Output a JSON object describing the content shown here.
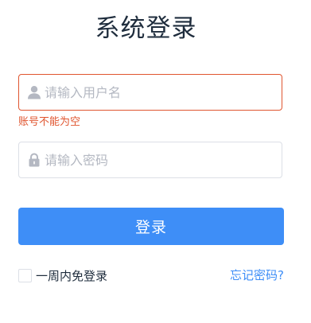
{
  "title": "系统登录",
  "username": {
    "placeholder": "请输入用户名",
    "value": "",
    "icon": "user-icon",
    "error": "账号不能为空"
  },
  "password": {
    "placeholder": "请输入密码",
    "value": "",
    "icon": "lock-icon"
  },
  "login_button": "登录",
  "remember_label": "一周内免登录",
  "remember_checked": false,
  "forgot_link": "忘记密码?",
  "colors": {
    "primary": "#3e8ef7",
    "error": "#e0552f",
    "icon": "#b4b8c2",
    "title": "#1f2d3d"
  }
}
